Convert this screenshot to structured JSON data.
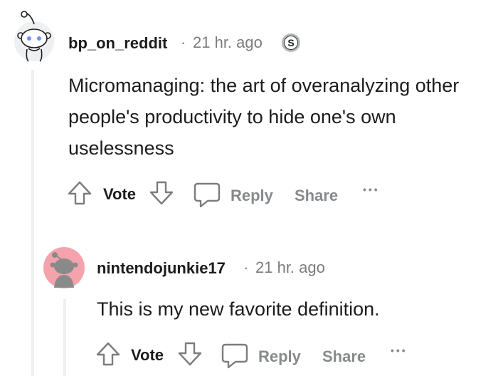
{
  "comments": [
    {
      "username": "bp_on_reddit",
      "separator": "·",
      "time": "21 hr. ago",
      "badge": "S",
      "body": "Micromanaging: the art of overanalyzing other people's productivity to hide one's own uselessness",
      "actions": {
        "vote": "Vote",
        "reply": "Reply",
        "share": "Share",
        "more": "•••"
      }
    },
    {
      "username": "nintendojunkie17",
      "separator": "·",
      "time": "21 hr. ago",
      "body": "This is my new favorite definition.",
      "actions": {
        "vote": "Vote",
        "reply": "Reply",
        "share": "Share",
        "more": "•••"
      }
    }
  ],
  "icons": {
    "avatar_1": "snoo-avatar-icon",
    "avatar_2": "snoo-avatar-icon",
    "upvote": "arrow-up-icon",
    "downvote": "arrow-down-icon",
    "reply": "speech-bubble-icon"
  },
  "colors": {
    "avatar_1_bg": "#eef0f2",
    "avatar_2_bg": "#f4a3ad",
    "muted_text": "#878a8c",
    "thread_line": "#edeff1"
  }
}
